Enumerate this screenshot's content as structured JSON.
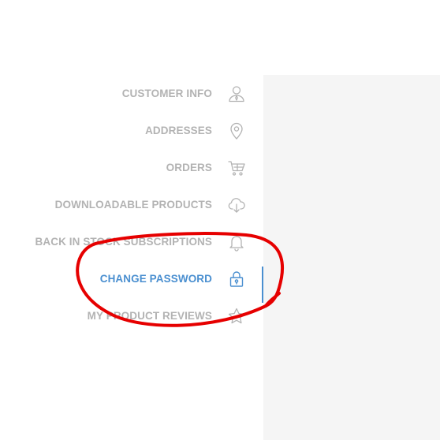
{
  "nav": {
    "items": [
      {
        "label": "CUSTOMER INFO",
        "icon": "user-icon",
        "active": false
      },
      {
        "label": "ADDRESSES",
        "icon": "map-pin-icon",
        "active": false
      },
      {
        "label": "ORDERS",
        "icon": "cart-icon",
        "active": false
      },
      {
        "label": "DOWNLOADABLE PRODUCTS",
        "icon": "cloud-download-icon",
        "active": false
      },
      {
        "label": "BACK IN STOCK SUBSCRIPTIONS",
        "icon": "bell-icon",
        "active": false
      },
      {
        "label": "CHANGE PASSWORD",
        "icon": "lock-icon",
        "active": true
      },
      {
        "label": "MY PRODUCT REVIEWS",
        "icon": "star-icon",
        "active": false
      }
    ]
  },
  "colors": {
    "inactive_text": "#b3b3b3",
    "active_text": "#4a8fd0",
    "active_bar": "#4a8fd0",
    "annotation": "#e60000",
    "content_bg": "#f5f5f5"
  }
}
